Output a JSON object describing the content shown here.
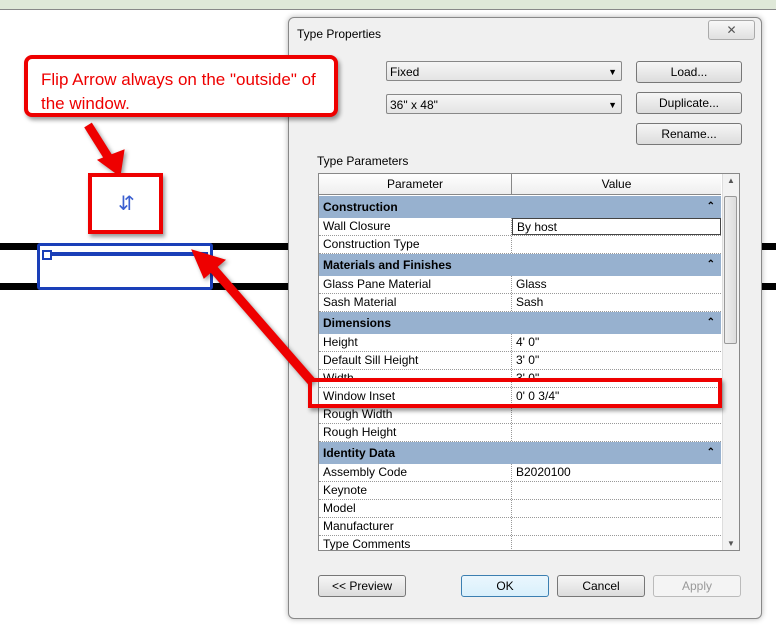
{
  "dialog": {
    "title": "Type Properties",
    "close_icon": "close-icon",
    "family": "Fixed",
    "type": "36\" x 48\"",
    "buttons": {
      "load": "Load...",
      "duplicate": "Duplicate...",
      "rename": "Rename...",
      "preview": "<< Preview",
      "ok": "OK",
      "cancel": "Cancel",
      "apply": "Apply"
    },
    "section_label": "Type Parameters",
    "table": {
      "headers": [
        "Parameter",
        "Value"
      ],
      "groups": [
        {
          "name": "Construction",
          "rows": [
            [
              "Wall Closure",
              "By host"
            ],
            [
              "Construction Type",
              ""
            ]
          ]
        },
        {
          "name": "Materials and Finishes",
          "rows": [
            [
              "Glass Pane Material",
              "Glass"
            ],
            [
              "Sash Material",
              "Sash"
            ]
          ]
        },
        {
          "name": "Dimensions",
          "rows": [
            [
              "Height",
              "4'  0\""
            ],
            [
              "Default Sill Height",
              "3'  0\""
            ],
            [
              "Width",
              "3'  0\""
            ],
            [
              "Window Inset",
              "0'  0 3/4\""
            ],
            [
              "Rough Width",
              ""
            ],
            [
              "Rough Height",
              ""
            ]
          ]
        },
        {
          "name": "Identity Data",
          "rows": [
            [
              "Assembly Code",
              "B2020100"
            ],
            [
              "Keynote",
              ""
            ],
            [
              "Model",
              ""
            ],
            [
              "Manufacturer",
              ""
            ],
            [
              "Type Comments",
              ""
            ]
          ]
        }
      ]
    }
  },
  "annotation": {
    "callout": "Flip Arrow always on the \"outside\" of the window.",
    "flip_icon": "flip-arrow-icon",
    "accent": "#e00000"
  }
}
